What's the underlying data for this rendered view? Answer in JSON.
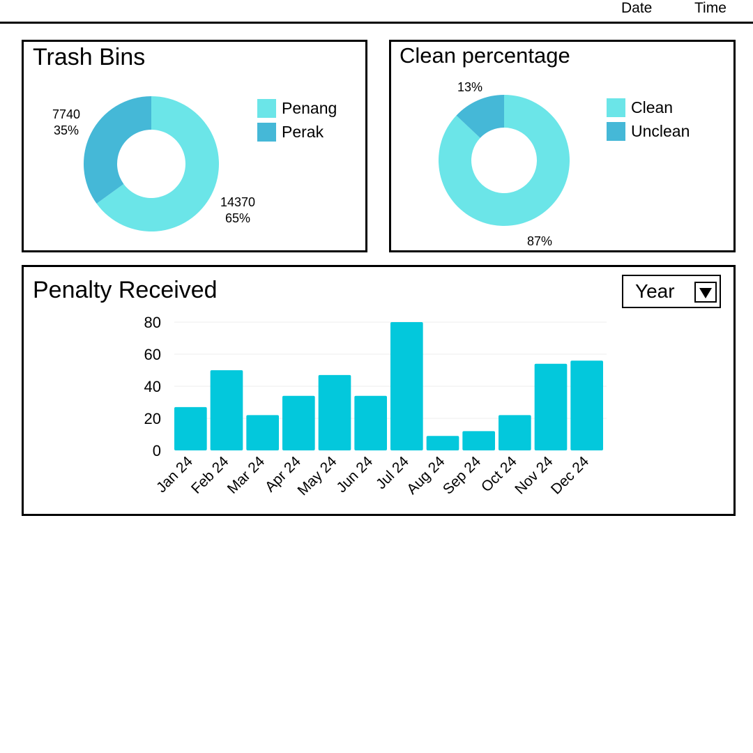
{
  "header": {
    "date_label": "Date",
    "time_label": "Time"
  },
  "colors": {
    "light_teal": "#6be5e8",
    "mid_teal": "#45b8d7",
    "bar_cyan": "#03c8dc"
  },
  "trash_bins": {
    "title": "Trash Bins",
    "legend": [
      {
        "label": "Penang",
        "color": "#6be5e8",
        "icon": "legend-swatch"
      },
      {
        "label": "Perak",
        "color": "#45b8d7",
        "icon": "legend-swatch"
      }
    ],
    "chart_data": {
      "type": "pie",
      "style": "donut",
      "slices": [
        {
          "name": "Penang",
          "value": 14370,
          "percent_label": "65%",
          "value_label": "14370",
          "color": "#6be5e8"
        },
        {
          "name": "Perak",
          "value": 7740,
          "percent_label": "35%",
          "value_label": "7740",
          "color": "#45b8d7"
        }
      ]
    }
  },
  "clean_percentage": {
    "title": "Clean percentage",
    "legend": [
      {
        "label": "Clean",
        "color": "#6be5e8",
        "icon": "legend-swatch"
      },
      {
        "label": "Unclean",
        "color": "#45b8d7",
        "icon": "legend-swatch"
      }
    ],
    "chart_data": {
      "type": "pie",
      "style": "donut",
      "slices": [
        {
          "name": "Clean",
          "value": 87,
          "percent_label": "87%",
          "color": "#6be5e8"
        },
        {
          "name": "Unclean",
          "value": 13,
          "percent_label": "13%",
          "color": "#45b8d7"
        }
      ]
    }
  },
  "penalty": {
    "title": "Penalty Received",
    "period_select": {
      "selected": "Year",
      "icon": "dropdown-arrow-icon"
    },
    "chart_data": {
      "type": "bar",
      "categories": [
        "Jan 24",
        "Feb 24",
        "Mar 24",
        "Apr 24",
        "May 24",
        "Jun 24",
        "Jul 24",
        "Aug 24",
        "Sep 24",
        "Oct 24",
        "Nov 24",
        "Dec 24"
      ],
      "values": [
        27,
        50,
        22,
        34,
        47,
        34,
        80,
        9,
        12,
        22,
        54,
        56
      ],
      "ylim": [
        0,
        80
      ],
      "yticks": [
        0,
        20,
        40,
        60,
        80
      ],
      "grid": true,
      "color": "#03c8dc"
    }
  }
}
